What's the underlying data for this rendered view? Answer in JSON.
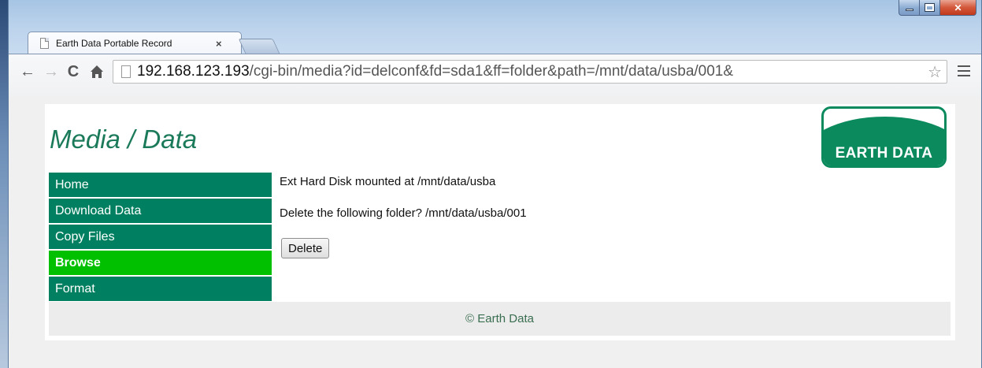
{
  "browser": {
    "tab_title": "Earth Data Portable Record",
    "tab_close": "×",
    "url_host": "192.168.123.193",
    "url_path": "/cgi-bin/media?id=delconf&fd=sda1&ff=folder&path=/mnt/data/usba/001&",
    "window_controls": {
      "minimize": "",
      "maximize": "",
      "close": "✕"
    }
  },
  "page": {
    "title": "Media / Data",
    "logo_text": "EARTH DATA",
    "nav": [
      {
        "label": "Home",
        "active": false
      },
      {
        "label": "Download Data",
        "active": false
      },
      {
        "label": "Copy Files",
        "active": false
      },
      {
        "label": "Browse",
        "active": true
      },
      {
        "label": "Format",
        "active": false
      }
    ],
    "mount_text": "Ext Hard Disk mounted at /mnt/data/usba",
    "confirm_text": "Delete the following folder? /mnt/data/usba/001",
    "delete_label": "Delete",
    "footer": "© Earth Data"
  },
  "colors": {
    "nav_bg": "#008060",
    "nav_active_bg": "#00c000",
    "title_color": "#1b7a5a",
    "logo_green": "#0b8a5e"
  }
}
